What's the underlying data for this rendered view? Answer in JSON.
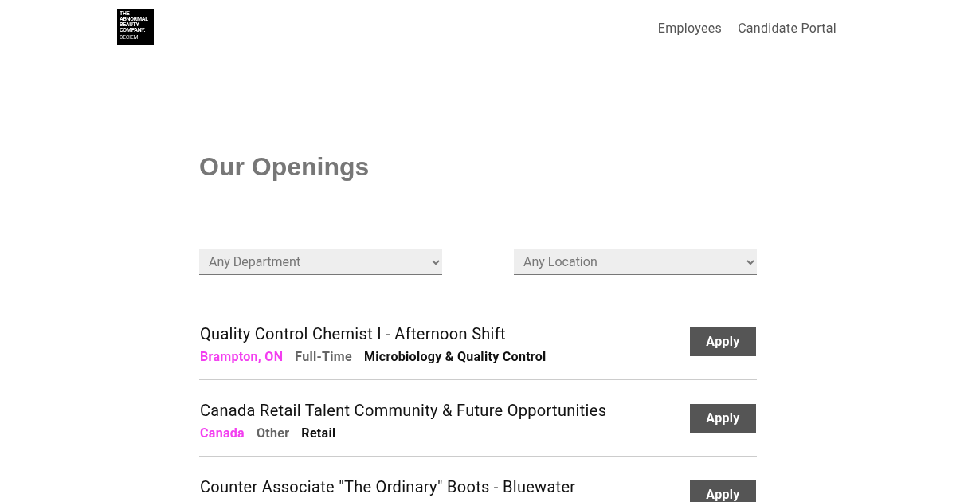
{
  "header": {
    "logo": {
      "lines": [
        "THE",
        "ABNORMAL",
        "BEAUTY",
        "COMPANY.",
        "DECIEM"
      ]
    },
    "nav": [
      "Employees",
      "Candidate Portal"
    ]
  },
  "heading": "Our Openings",
  "filters": [
    {
      "value": "Any Department"
    },
    {
      "value": "Any Location"
    }
  ],
  "jobs": [
    {
      "title": "Quality Control Chemist I - Afternoon Shift",
      "location": "Brampton, ON",
      "type": "Full-Time",
      "department": "Microbiology & Quality Control",
      "button": "Apply"
    },
    {
      "title": "Canada Retail Talent Community & Future Opportunities",
      "location": "Canada",
      "type": "Other",
      "department": "Retail",
      "button": "Apply"
    },
    {
      "title": "Counter Associate \"The Ordinary\" Boots - Bluewater",
      "button": "Apply"
    }
  ]
}
